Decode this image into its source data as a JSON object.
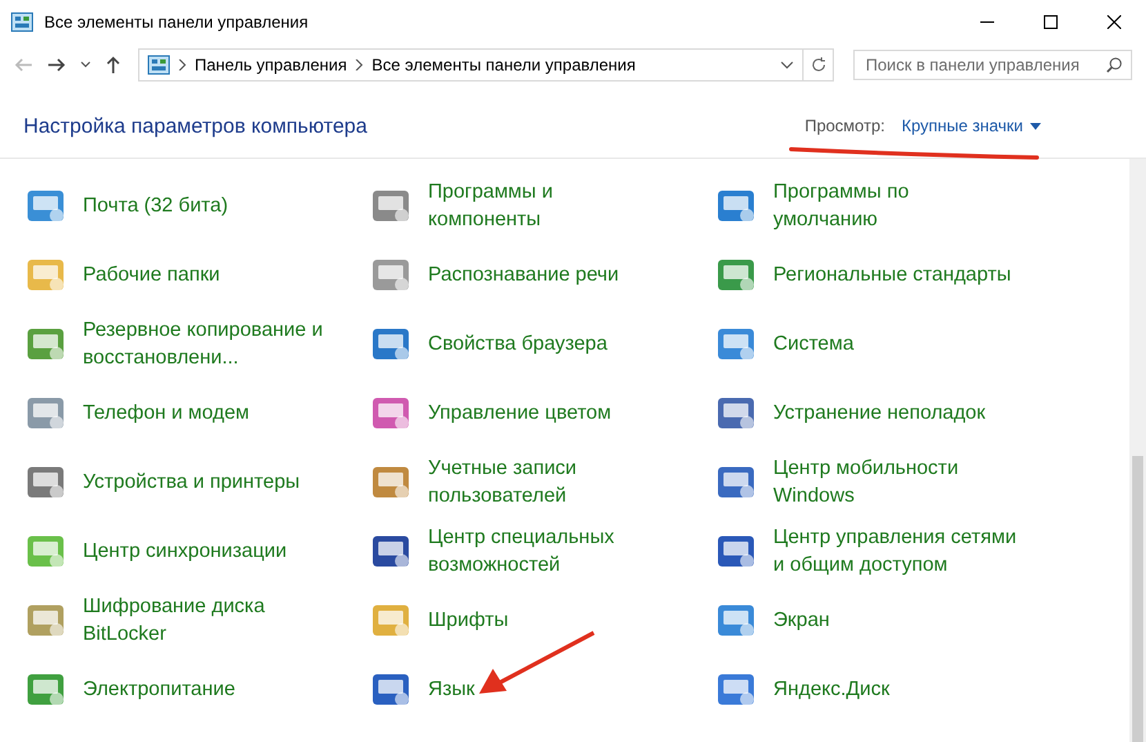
{
  "window": {
    "title": "Все элементы панели управления"
  },
  "address": {
    "crumbs": [
      "Панель управления",
      "Все элементы панели управления"
    ]
  },
  "search": {
    "placeholder": "Поиск в панели управления"
  },
  "heading": "Настройка параметров компьютера",
  "view": {
    "label": "Просмотр:",
    "value": "Крупные значки"
  },
  "items": [
    {
      "lines": [
        "Почта (32 бита)"
      ]
    },
    {
      "lines": [
        "Программы и",
        "компоненты"
      ]
    },
    {
      "lines": [
        "Программы по",
        "умолчанию"
      ]
    },
    {
      "lines": [
        "Рабочие папки"
      ]
    },
    {
      "lines": [
        "Распознавание речи"
      ]
    },
    {
      "lines": [
        "Региональные стандарты"
      ]
    },
    {
      "lines": [
        "Резервное копирование и",
        "восстановлени..."
      ]
    },
    {
      "lines": [
        "Свойства браузера"
      ]
    },
    {
      "lines": [
        "Система"
      ]
    },
    {
      "lines": [
        "Телефон и модем"
      ]
    },
    {
      "lines": [
        "Управление цветом"
      ]
    },
    {
      "lines": [
        "Устранение неполадок"
      ]
    },
    {
      "lines": [
        "Устройства и принтеры"
      ]
    },
    {
      "lines": [
        "Учетные записи",
        "пользователей"
      ]
    },
    {
      "lines": [
        "Центр мобильности",
        "Windows"
      ]
    },
    {
      "lines": [
        "Центр синхронизации"
      ]
    },
    {
      "lines": [
        "Центр специальных",
        "возможностей"
      ]
    },
    {
      "lines": [
        "Центр управления сетями",
        "и общим доступом"
      ]
    },
    {
      "lines": [
        "Шифрование диска",
        "BitLocker"
      ]
    },
    {
      "lines": [
        "Шрифты"
      ]
    },
    {
      "lines": [
        "Экран"
      ]
    },
    {
      "lines": [
        "Электропитание"
      ]
    },
    {
      "lines": [
        "Язык"
      ]
    },
    {
      "lines": [
        "Яндекс.Диск"
      ]
    }
  ]
}
